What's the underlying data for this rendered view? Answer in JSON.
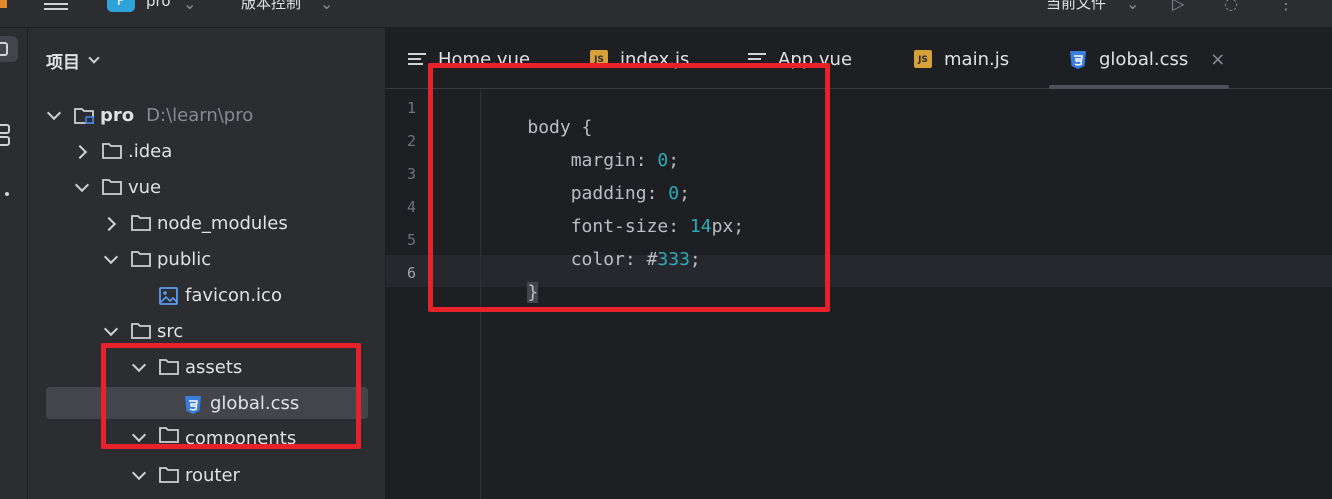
{
  "titlebar": {
    "project_initial": "P",
    "project_name": "pro",
    "vcs_label": "版本控制",
    "run_config": "当前文件"
  },
  "project_panel": {
    "title": "项目",
    "tree": [
      {
        "label": "pro",
        "path": "D:\\learn\\pro",
        "expanded": true,
        "bold": true
      },
      {
        "label": ".idea",
        "expanded": false
      },
      {
        "label": "vue",
        "expanded": true
      },
      {
        "label": "node_modules",
        "expanded": false
      },
      {
        "label": "public",
        "expanded": true
      },
      {
        "label": "favicon.ico"
      },
      {
        "label": "src",
        "expanded": true
      },
      {
        "label": "assets",
        "expanded": true
      },
      {
        "label": "global.css",
        "selected": true
      },
      {
        "label": "components",
        "expanded": true
      },
      {
        "label": "router",
        "expanded": true
      }
    ]
  },
  "editor": {
    "tabs": [
      {
        "label": "Home.vue",
        "icon": "text-lines-icon"
      },
      {
        "label": "index.js",
        "icon": "js-icon"
      },
      {
        "label": "App.vue",
        "icon": "text-lines-icon"
      },
      {
        "label": "main.js",
        "icon": "js-icon"
      },
      {
        "label": "global.css",
        "icon": "css-icon",
        "active": true,
        "close": "×"
      }
    ],
    "line_numbers": [
      "1",
      "2",
      "3",
      "4",
      "5",
      "6"
    ],
    "code": {
      "l1_selector": "body ",
      "l1_brace": "{",
      "l2_prop": "    margin: ",
      "l2_val": "0",
      "l2_end": ";",
      "l3_prop": "    padding: ",
      "l3_val": "0",
      "l3_end": ";",
      "l4_prop": "    font-size: ",
      "l4_val": "14",
      "l4_unit": "px;",
      "l5_prop": "    color: #",
      "l5_val": "333",
      "l5_end": ";",
      "l6_brace": "}"
    }
  },
  "colors": {
    "annotation": "#e8222a",
    "css_icon": "#3b7ddd",
    "js_icon": "#d7a13a",
    "number_token": "#2aacb8"
  }
}
